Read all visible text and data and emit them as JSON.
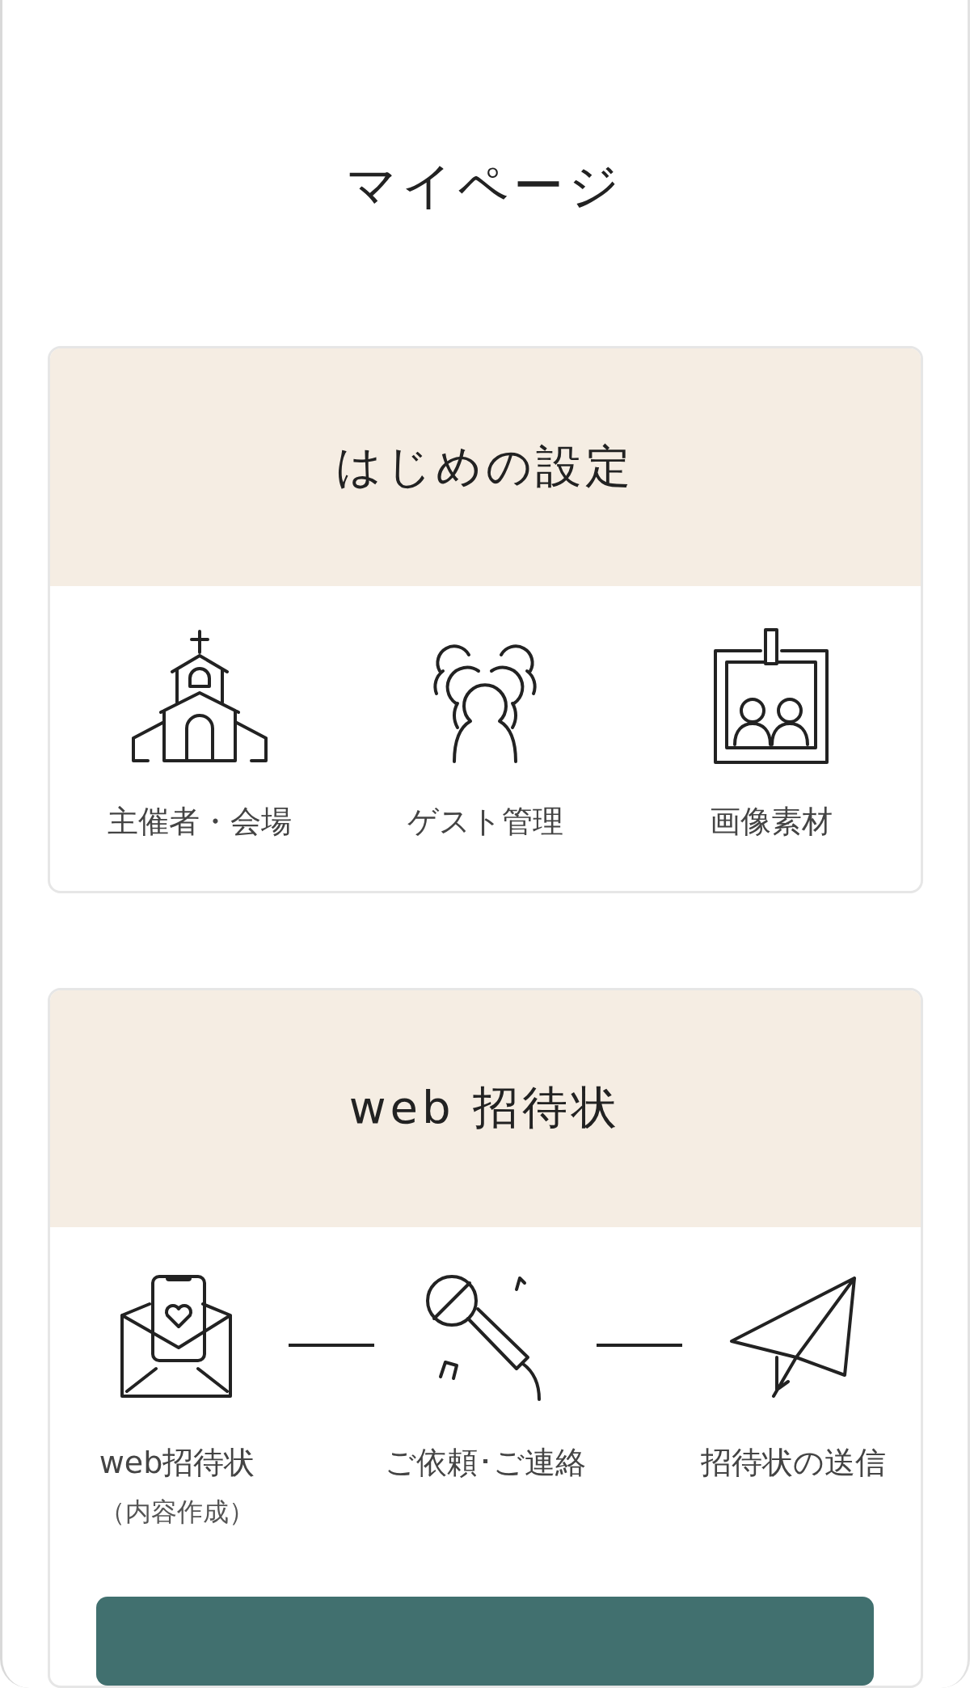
{
  "title": "マイページ",
  "sections": [
    {
      "title": "はじめの設定",
      "connected": false,
      "items": [
        {
          "kind": "church",
          "label": "主催者・会場"
        },
        {
          "kind": "guests",
          "label": "ゲスト管理"
        },
        {
          "kind": "photo",
          "label": "画像素材"
        }
      ]
    },
    {
      "title": "web 招待状",
      "connected": true,
      "items": [
        {
          "kind": "invitation",
          "label": "web招待状",
          "sublabel": "（内容作成）"
        },
        {
          "kind": "microphone",
          "label": "ご依頼･ご連絡"
        },
        {
          "kind": "plane",
          "label": "招待状の送信"
        }
      ]
    }
  ]
}
